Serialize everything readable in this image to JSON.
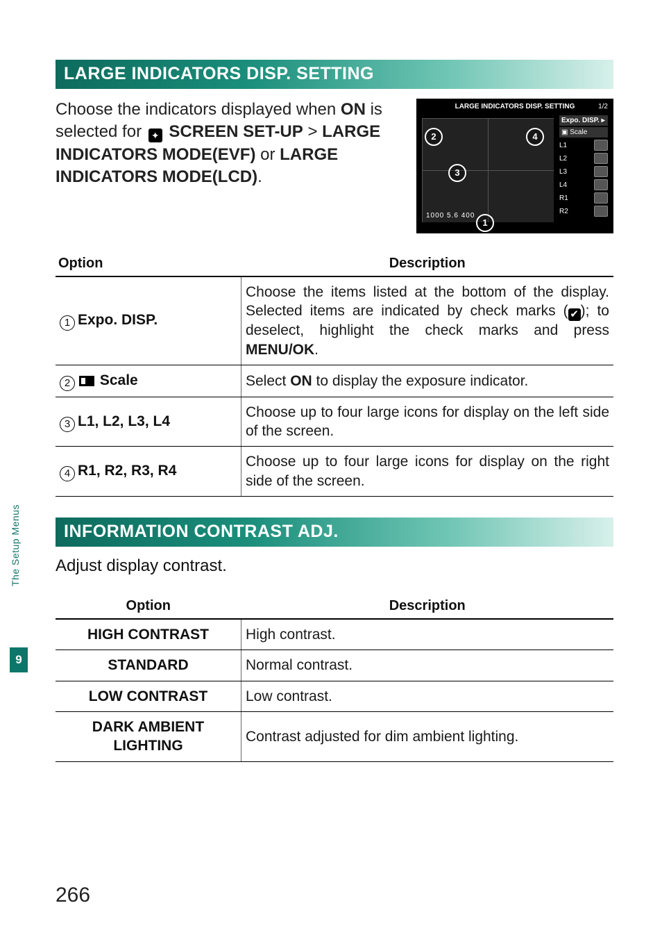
{
  "sidebar": {
    "label": "The Setup Menus",
    "chapter": "9"
  },
  "page_number": "266",
  "section1": {
    "title": "LARGE INDICATORS DISP. SETTING",
    "intro_pre": "Choose the indicators displayed when ",
    "intro_on": "ON",
    "intro_mid": " is selected for ",
    "intro_setup": " SCREEN SET-UP",
    "intro_gt": " > ",
    "intro_evf": "LARGE INDICATORS MODE(EVF)",
    "intro_or": " or ",
    "intro_lcd": "LARGE INDICATORS MODE(LCD)",
    "intro_end": ".",
    "cam": {
      "title": "LARGE INDICATORS DISP. SETTING",
      "page": "1/2",
      "expo": "Expo. DISP.",
      "scale": "Scale",
      "rows": [
        "L1",
        "L2",
        "L3",
        "L4",
        "R1",
        "R2"
      ],
      "bottom": "1000   5.6           400"
    },
    "table": {
      "head_option": "Option",
      "head_desc": "Description",
      "rows": [
        {
          "num": "1",
          "label": "Expo. DISP.",
          "desc_pre": "Choose the items listed at the bottom of the display. Selected items are indicated by check marks (",
          "desc_post": "); to deselect, highlight the check marks and press ",
          "desc_menu": "MENU/OK",
          "desc_end": "."
        },
        {
          "num": "2",
          "label": " Scale",
          "desc_pre": "Select ",
          "desc_bold": "ON",
          "desc_post": " to display the exposure indicator."
        },
        {
          "num": "3",
          "label": "L1, L2, L3, L4",
          "desc": "Choose up to four large icons for display on the left side of the screen."
        },
        {
          "num": "4",
          "label": "R1, R2, R3, R4",
          "desc": "Choose up to four large icons for display on the right side of the screen."
        }
      ]
    }
  },
  "section2": {
    "title": "INFORMATION CONTRAST ADJ.",
    "intro": "Adjust display contrast.",
    "table": {
      "head_option": "Option",
      "head_desc": "Description",
      "rows": [
        {
          "label": "HIGH CONTRAST",
          "desc": "High contrast."
        },
        {
          "label": "STANDARD",
          "desc": "Normal contrast."
        },
        {
          "label": "LOW CONTRAST",
          "desc": "Low contrast."
        },
        {
          "label": "DARK AMBIENT LIGHTING",
          "desc": "Contrast adjusted for dim ambient lighting."
        }
      ]
    }
  }
}
